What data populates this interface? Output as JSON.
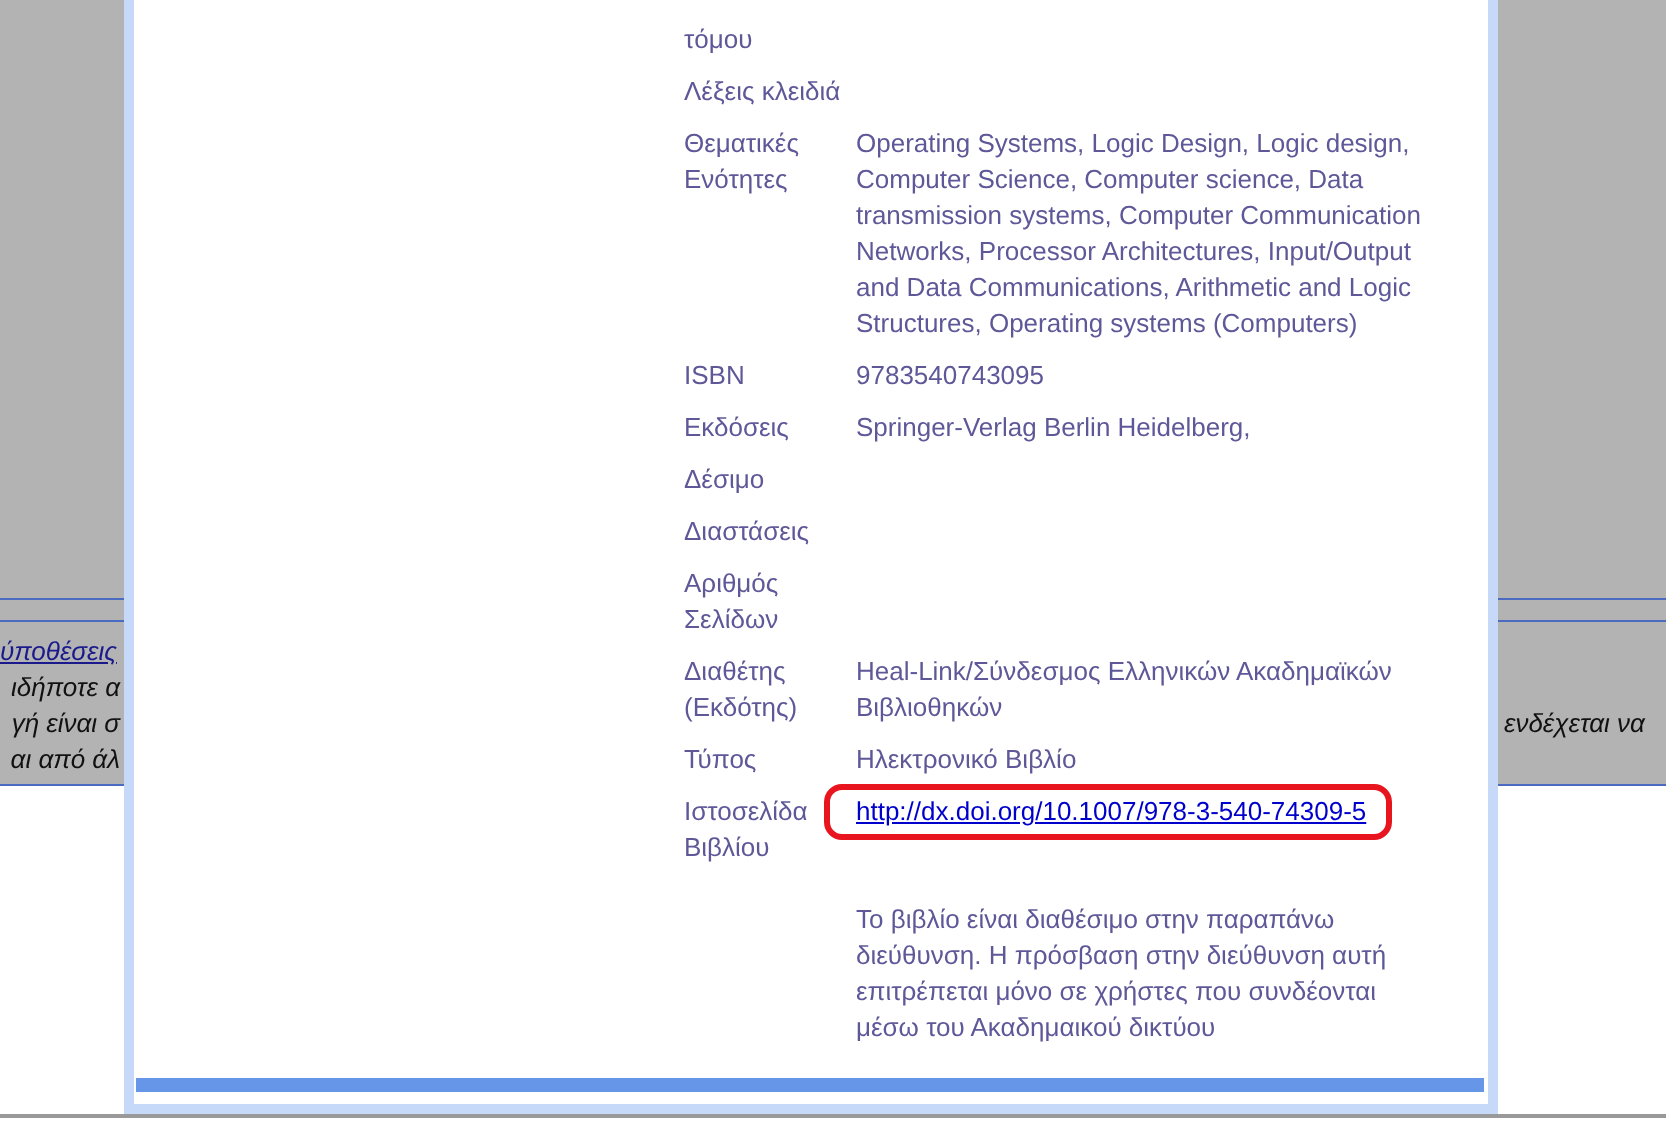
{
  "background_page": {
    "link": "ύποθέσεις",
    "text_lines_left": [
      "ιδήποτε α",
      "γή είναι σ",
      "αι από άλ"
    ],
    "text_right": "ενδέχεται να"
  },
  "details": {
    "rows": [
      {
        "kind": "text",
        "label": "τόμου"
      },
      {
        "kind": "text",
        "label": "Λέξεις κλειδιά"
      },
      {
        "kind": "text",
        "label": "Θεματικές Ενότητες",
        "value": "Operating Systems, Logic Design, Logic design, Computer Science, Computer science, Data transmission systems, Computer Communication Networks, Processor Architectures, Input/Output and Data Communications, Arithmetic and Logic Structures, Operating systems (Computers)"
      },
      {
        "kind": "text",
        "label": "ISBN",
        "value": "9783540743095"
      },
      {
        "kind": "text",
        "label": "Εκδόσεις",
        "value": "Springer-Verlag Berlin Heidelberg,"
      },
      {
        "kind": "text",
        "label": "Δέσιμο"
      },
      {
        "kind": "text",
        "label": "Διαστάσεις"
      },
      {
        "kind": "text",
        "label": "Αριθμός Σελίδων"
      },
      {
        "kind": "text",
        "label": "Διαθέτης (Εκδότης)",
        "value": "Heal-Link/Σύνδεσμος Ελληνικών Ακαδημαϊκών Βιβλιοθηκών"
      },
      {
        "kind": "text",
        "label": "Τύπος",
        "value": "Ηλεκτρονικό Βιβλίο"
      },
      {
        "kind": "link",
        "label": "Ιστοσελίδα Βιβλίου",
        "value": "http://dx.doi.org/10.1007/978-3-540-74309-5",
        "highlighted": true
      },
      {
        "kind": "note",
        "value": "Το βιβλίο είναι διαθέσιμο στην παραπάνω διεύθυνση. Η πρόσβαση στην διεύθυνση αυτή επιτρέπεται μόνο σε χρήστες που συνδέονται μέσω του Ακαδημαικού δικτύου"
      }
    ]
  }
}
